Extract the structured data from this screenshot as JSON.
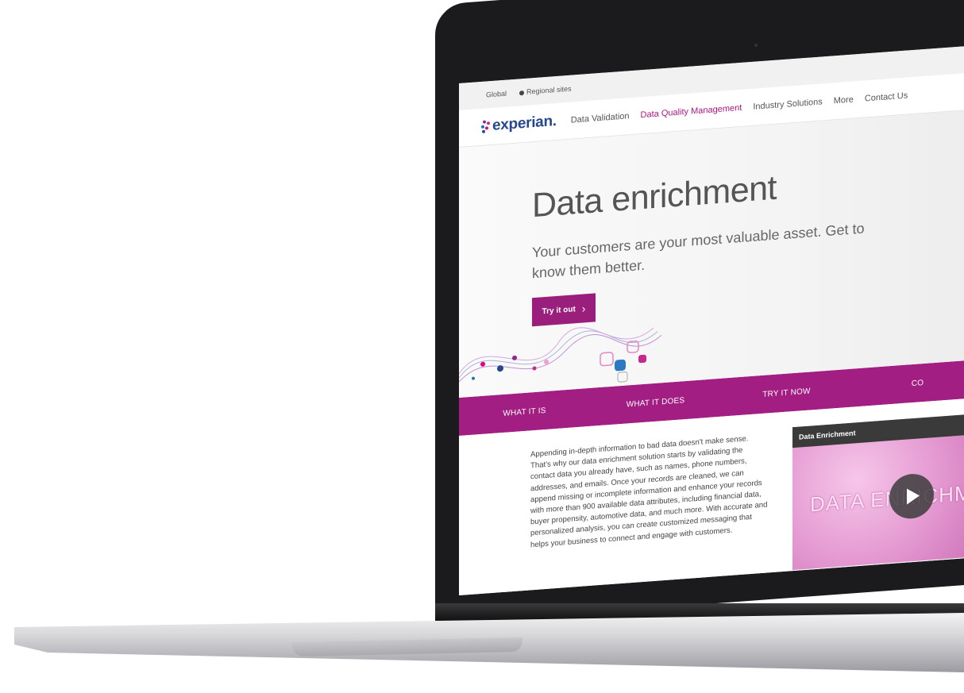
{
  "topbar": {
    "global": "Global",
    "regional": "Regional sites"
  },
  "brand": {
    "logo_text": "experian.",
    "accent": "#a21e82",
    "logo_blue": "#26478d"
  },
  "nav": {
    "items": [
      {
        "label": "Data Validation"
      },
      {
        "label": "Data Quality Management"
      },
      {
        "label": "Industry Solutions"
      },
      {
        "label": "More"
      },
      {
        "label": "Contact Us"
      }
    ]
  },
  "hero": {
    "title": "Data enrichment",
    "subtitle": "Your customers are your most valuable asset. Get to know them better.",
    "cta_label": "Try it out"
  },
  "subnav": {
    "tabs": [
      {
        "label": "WHAT IT IS"
      },
      {
        "label": "WHAT IT DOES"
      },
      {
        "label": "TRY IT NOW"
      },
      {
        "label": "CO"
      }
    ]
  },
  "content": {
    "body": "Appending in-depth information to bad data doesn't make sense. That's why our data enrichment solution starts by validating the contact data you already have, such as names, phone numbers, addresses, and emails. Once your records are cleaned, we can append missing or incomplete information and enhance your records with more than 900 available data attributes, including financial data, buyer propensity, automotive data, and much more. With accurate and personalized analysis, you can create customized messaging that helps your business to connect and engage with customers."
  },
  "video": {
    "title": "Data Enrichment",
    "overlay_text": "DATA ENRICHMENT",
    "play_icon": "play-icon"
  }
}
